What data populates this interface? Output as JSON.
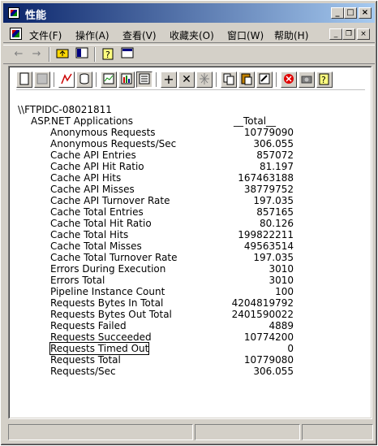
{
  "window": {
    "title": "性能"
  },
  "menu": {
    "items": [
      "文件(F)",
      "操作(A)",
      "查看(V)",
      "收藏夹(O)",
      "窗口(W)",
      "帮助(H)"
    ]
  },
  "toolbar1": {
    "icons": [
      "back-arrow-icon",
      "forward-arrow-icon",
      "up-folder-icon",
      "show-tree-icon",
      "help-icon",
      "console-icon"
    ]
  },
  "toolbar2": {
    "icons": [
      "new-counter-set-icon",
      "clear-display-icon",
      "view-chart-icon",
      "view-histogram-icon",
      "view-report-icon",
      "add-icon",
      "delete-icon",
      "highlight-icon",
      "copy-icon",
      "paste-icon",
      "properties-icon",
      "freeze-icon",
      "update-data-icon",
      "help-icon"
    ]
  },
  "report": {
    "machine": "\\\\FTPIDC-08021811",
    "object": "ASP.NET Applications",
    "column": "__Total__",
    "counters": [
      {
        "name": "Anonymous Requests",
        "value": "10779090"
      },
      {
        "name": "Anonymous Requests/Sec",
        "value": "306.055"
      },
      {
        "name": "Cache API Entries",
        "value": "857072"
      },
      {
        "name": "Cache API Hit Ratio",
        "value": "81.197"
      },
      {
        "name": "Cache API Hits",
        "value": "167463188"
      },
      {
        "name": "Cache API Misses",
        "value": "38779752"
      },
      {
        "name": "Cache API Turnover Rate",
        "value": "197.035"
      },
      {
        "name": "Cache Total Entries",
        "value": "857165"
      },
      {
        "name": "Cache Total Hit Ratio",
        "value": "80.126"
      },
      {
        "name": "Cache Total Hits",
        "value": "199822211"
      },
      {
        "name": "Cache Total Misses",
        "value": "49563514"
      },
      {
        "name": "Cache Total Turnover Rate",
        "value": "197.035"
      },
      {
        "name": "Errors During Execution",
        "value": "3010"
      },
      {
        "name": "Errors Total",
        "value": "3010"
      },
      {
        "name": "Pipeline Instance Count",
        "value": "100"
      },
      {
        "name": "Requests Bytes In Total",
        "value": "4204819792"
      },
      {
        "name": "Requests Bytes Out Total",
        "value": "2401590022"
      },
      {
        "name": "Requests Failed",
        "value": "4889"
      },
      {
        "name": "Requests Succeeded",
        "value": "10774200"
      },
      {
        "name": "Requests Timed Out",
        "value": "0"
      },
      {
        "name": "Requests Total",
        "value": "10779080"
      },
      {
        "name": "Requests/Sec",
        "value": "306.055"
      }
    ]
  },
  "status": {
    "panels": [
      "",
      "",
      ""
    ]
  }
}
